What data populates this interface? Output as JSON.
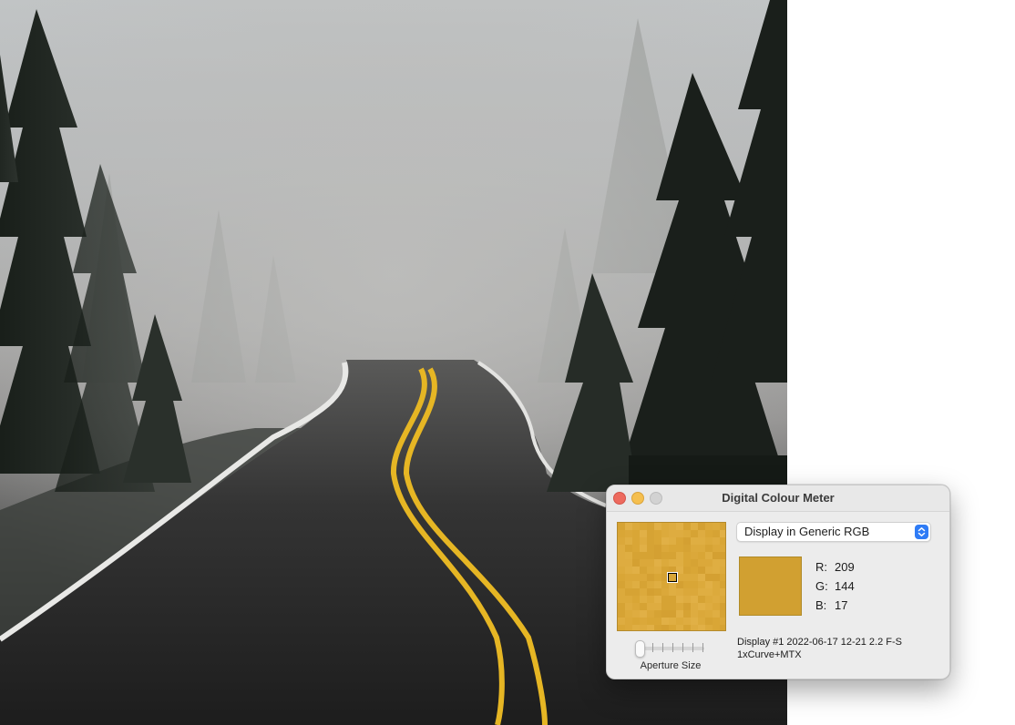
{
  "window": {
    "title": "Digital Colour Meter",
    "display_mode": "Display in Generic RGB",
    "aperture_label": "Aperture Size",
    "aperture_level": 0,
    "rgb": [
      {
        "key": "R:",
        "value": "209"
      },
      {
        "key": "G:",
        "value": "144"
      },
      {
        "key": "B:",
        "value": "17"
      }
    ],
    "profile_line1": "Display #1 2022-06-17 12-21 2.2 F-S",
    "profile_line2": "1xCurve+MTX",
    "sampled_color": "#d1a031"
  },
  "colors": {
    "close": "#ed6a5e",
    "minimize": "#f5bf4f",
    "zoom": "#d2d2d2",
    "accent": "#2f7cf6",
    "magnifier_base": "#dcaa3c",
    "road_line": "#e6b624"
  },
  "background": {
    "scene": "foggy-forest-road-photo"
  }
}
